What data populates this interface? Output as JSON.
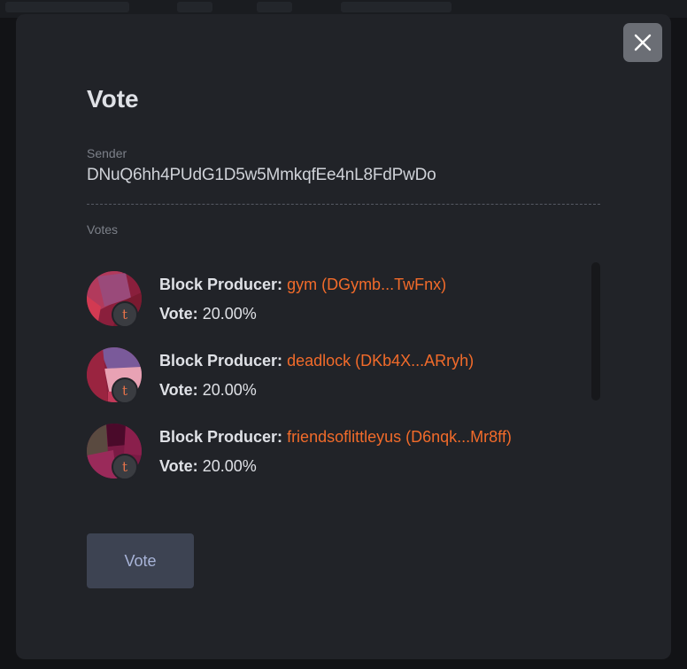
{
  "modal": {
    "title": "Vote",
    "sender_label": "Sender",
    "sender_value": "DNuQ6hh4PUdG1D5w5MmkqfEe4nL8FdPwDo",
    "votes_label": "Votes",
    "producer_label": "Block Producer:",
    "vote_label": "Vote:",
    "submit_label": "Vote",
    "close_icon": "close-icon",
    "badge_letter": "t"
  },
  "votes": [
    {
      "producer": "gym (DGymb...TwFnx)",
      "percent": "20.00%"
    },
    {
      "producer": "deadlock (DKb4X...ARryh)",
      "percent": "20.00%"
    },
    {
      "producer": "friendsoflittleyus (D6nqk...Mr8ff)",
      "percent": "20.00%"
    }
  ],
  "colors": {
    "accent": "#f26b2a",
    "modal_bg": "#212328",
    "button_bg": "#3d4352"
  }
}
